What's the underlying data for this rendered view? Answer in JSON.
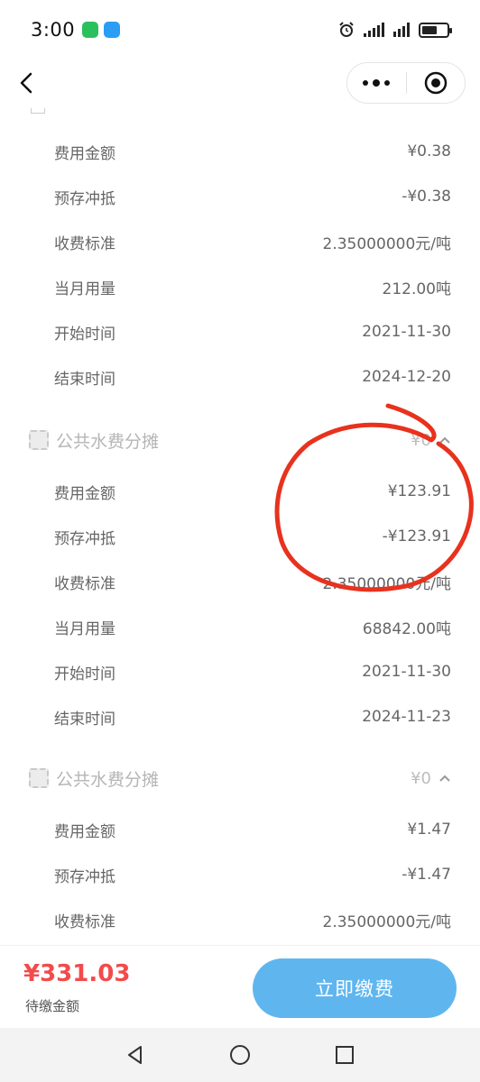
{
  "status_bar": {
    "time": "3:00",
    "apps": [
      "wechat-icon",
      "message-icon"
    ],
    "indicators": [
      "alarm-icon",
      "signal-icon",
      "signal-icon",
      "battery-icon"
    ]
  },
  "nav": {
    "back_icon": "chevron-left-icon",
    "more_icon": "more-dots-icon",
    "close_icon": "target-close-icon"
  },
  "group1_rows": [
    {
      "label": "费用金额",
      "value": "¥0.38"
    },
    {
      "label": "预存冲抵",
      "value": "-¥0.38"
    },
    {
      "label": "收费标准",
      "value": "2.35000000元/吨"
    },
    {
      "label": "当月用量",
      "value": "212.00吨"
    },
    {
      "label": "开始时间",
      "value": "2021-11-30"
    },
    {
      "label": "结束时间",
      "value": "2024-12-20"
    }
  ],
  "group2": {
    "title": "公共水费分摊",
    "amount": "¥0",
    "rows": [
      {
        "label": "费用金额",
        "value": "¥123.91"
      },
      {
        "label": "预存冲抵",
        "value": "-¥123.91"
      },
      {
        "label": "收费标准",
        "value": "2.35000000元/吨"
      },
      {
        "label": "当月用量",
        "value": "68842.00吨"
      },
      {
        "label": "开始时间",
        "value": "2021-11-30"
      },
      {
        "label": "结束时间",
        "value": "2024-11-23"
      }
    ]
  },
  "group3": {
    "title": "公共水费分摊",
    "amount": "¥0",
    "rows": [
      {
        "label": "费用金额",
        "value": "¥1.47"
      },
      {
        "label": "预存冲抵",
        "value": "-¥1.47"
      },
      {
        "label": "收费标准",
        "value": "2.35000000元/吨"
      }
    ]
  },
  "payment": {
    "amount": "¥331.03",
    "amount_label": "待缴金额",
    "button_label": "立即缴费"
  },
  "colors": {
    "accent": "#5fb6ef",
    "amount_red": "#f24b4b",
    "annotation_red": "#e8321e"
  }
}
